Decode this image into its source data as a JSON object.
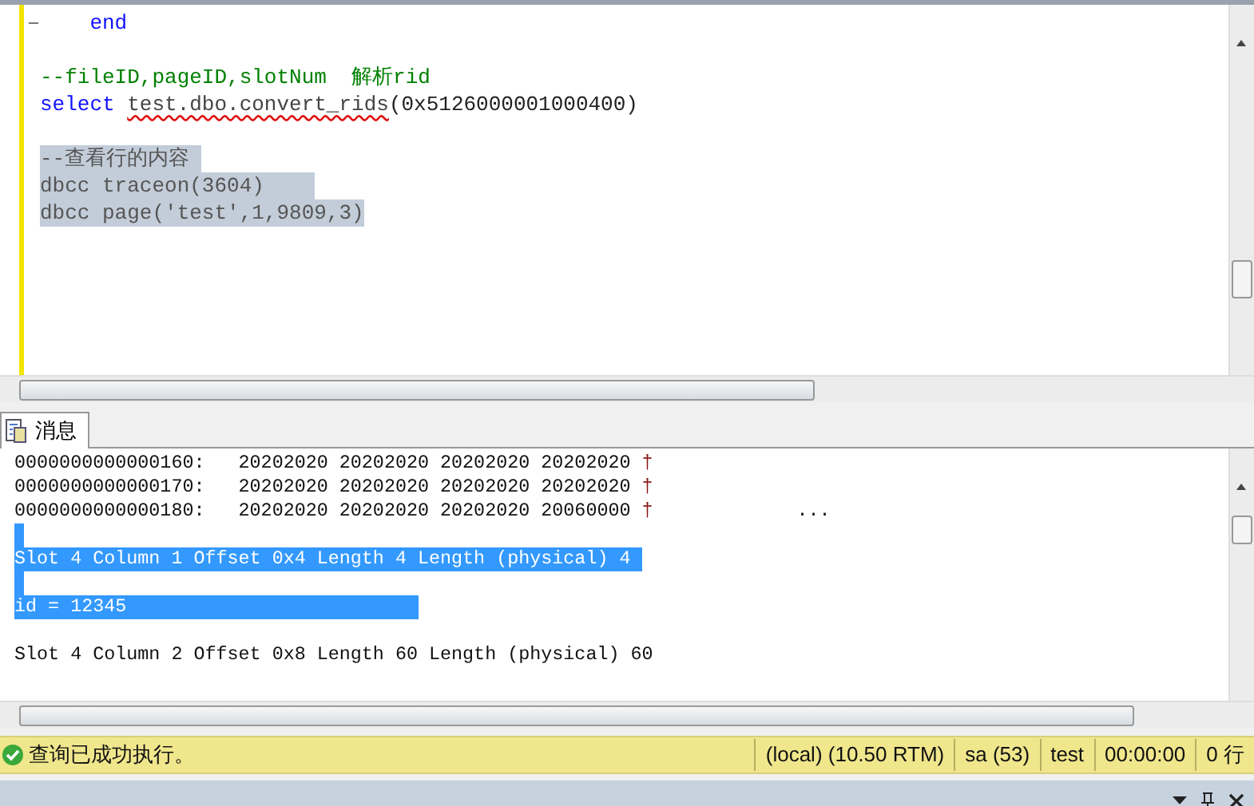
{
  "editor": {
    "lines": [
      {
        "selected": false,
        "collapse": true,
        "segments": [
          {
            "kind": "keyword",
            "text": "    end"
          }
        ]
      },
      {
        "kind": "blank"
      },
      {
        "selected": false,
        "collapse": false,
        "segments": [
          {
            "kind": "comment",
            "text": "--fileID,pageID,slotNum  解析rid"
          }
        ]
      },
      {
        "selected": false,
        "collapse": false,
        "segments": [
          {
            "kind": "keyword",
            "text": "select "
          },
          {
            "kind": "squiggle",
            "text": "test.dbo.convert_rids"
          },
          {
            "kind": "plain",
            "text": "(0x5126000001000400)"
          }
        ]
      },
      {
        "kind": "blank"
      },
      {
        "selected": true,
        "collapse": false,
        "segments": [
          {
            "kind": "gray",
            "text": "--查看行的内容 "
          }
        ]
      },
      {
        "selected": true,
        "collapse": false,
        "segments": [
          {
            "kind": "gray",
            "text": "dbcc traceon(3604)    "
          }
        ]
      },
      {
        "selected": true,
        "collapse": false,
        "segments": [
          {
            "kind": "gray",
            "text": "dbcc page('test',1,9809,3)"
          }
        ]
      }
    ]
  },
  "results_tab": {
    "label": "消息",
    "selected": true
  },
  "messages": [
    {
      "selected": false,
      "text": "0000000000000160:   20202020 20202020 20202020 20202020 ",
      "mark": "†"
    },
    {
      "selected": false,
      "text": "0000000000000170:   20202020 20202020 20202020 20202020 ",
      "mark": "†"
    },
    {
      "selected": false,
      "text": "0000000000000180:   20202020 20202020 20202020 20060000 ",
      "mark": "†",
      "tail": "..."
    },
    {
      "kind": "blank",
      "selected": true
    },
    {
      "selected": true,
      "text": "Slot 4 Column 1 Offset 0x4 Length 4 Length (physical) 4 "
    },
    {
      "kind": "blank",
      "selected": true
    },
    {
      "selected": true,
      "text": "id = 12345                          "
    },
    {
      "kind": "blank"
    },
    {
      "selected": false,
      "text": "Slot 4 Column 2 Offset 0x8 Length 60 Length (physical) 60"
    }
  ],
  "status_bar": {
    "message": "查询已成功执行。",
    "server": "(local) (10.50 RTM)",
    "user": "sa (53)",
    "database": "test",
    "elapsed": "00:00:00",
    "rows": "0 行"
  }
}
